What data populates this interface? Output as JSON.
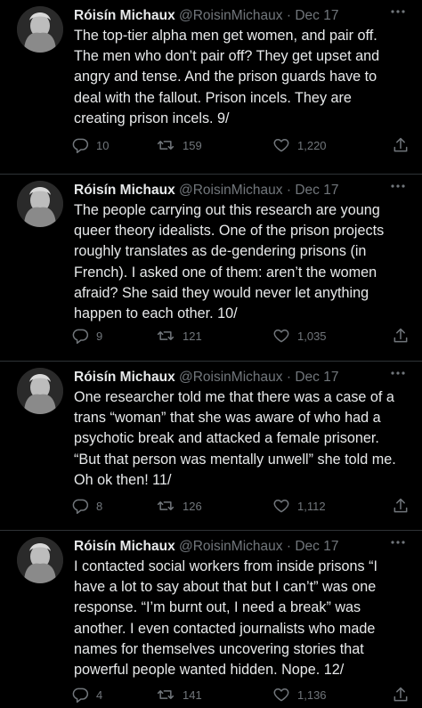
{
  "tweets": [
    {
      "author": "Róisín Michaux",
      "handle": "@RoisinMichaux",
      "separator": "·",
      "date": "Dec 17",
      "text": "The top-tier alpha men get women, and pair off. The men who don’t pair off? They get upset and angry and tense. And the prison guards have to deal with the fallout. Prison incels. They are creating prison incels. 9/",
      "replies": "10",
      "retweets": "159",
      "likes": "1,220"
    },
    {
      "author": "Róisín Michaux",
      "handle": "@RoisinMichaux",
      "separator": "·",
      "date": "Dec 17",
      "text": "The people carrying out this research are young queer theory idealists. One of the prison projects roughly translates as de-gendering prisons (in French). I asked one of them: aren’t the women afraid? She said they would never let anything happen to each other. 10/",
      "replies": "9",
      "retweets": "121",
      "likes": "1,035"
    },
    {
      "author": "Róisín Michaux",
      "handle": "@RoisinMichaux",
      "separator": "·",
      "date": "Dec 17",
      "text": "One researcher told me that there was a case of a trans “woman” that she was aware of who had a psychotic break and attacked a female prisoner. “But that person was mentally unwell” she told me. Oh ok then! 11/",
      "replies": "8",
      "retweets": "126",
      "likes": "1,112"
    },
    {
      "author": "Róisín Michaux",
      "handle": "@RoisinMichaux",
      "separator": "·",
      "date": "Dec 17",
      "text": "I contacted social workers from inside prisons “I have a lot to say about that but I can’t” was one response. “I’m burnt out, I need a break” was another. I even contacted journalists who made names for themselves uncovering stories that powerful people wanted hidden. Nope. 12/",
      "replies": "4",
      "retweets": "141",
      "likes": "1,136"
    }
  ],
  "icons": {
    "reply": "reply-icon",
    "retweet": "retweet-icon",
    "like": "heart-icon",
    "share": "share-icon",
    "more": "more-icon",
    "avatar": "avatar"
  },
  "colors": {
    "background": "#000000",
    "primary_text": "#e7e9ea",
    "secondary_text": "#71767b",
    "divider": "#2f3336"
  }
}
